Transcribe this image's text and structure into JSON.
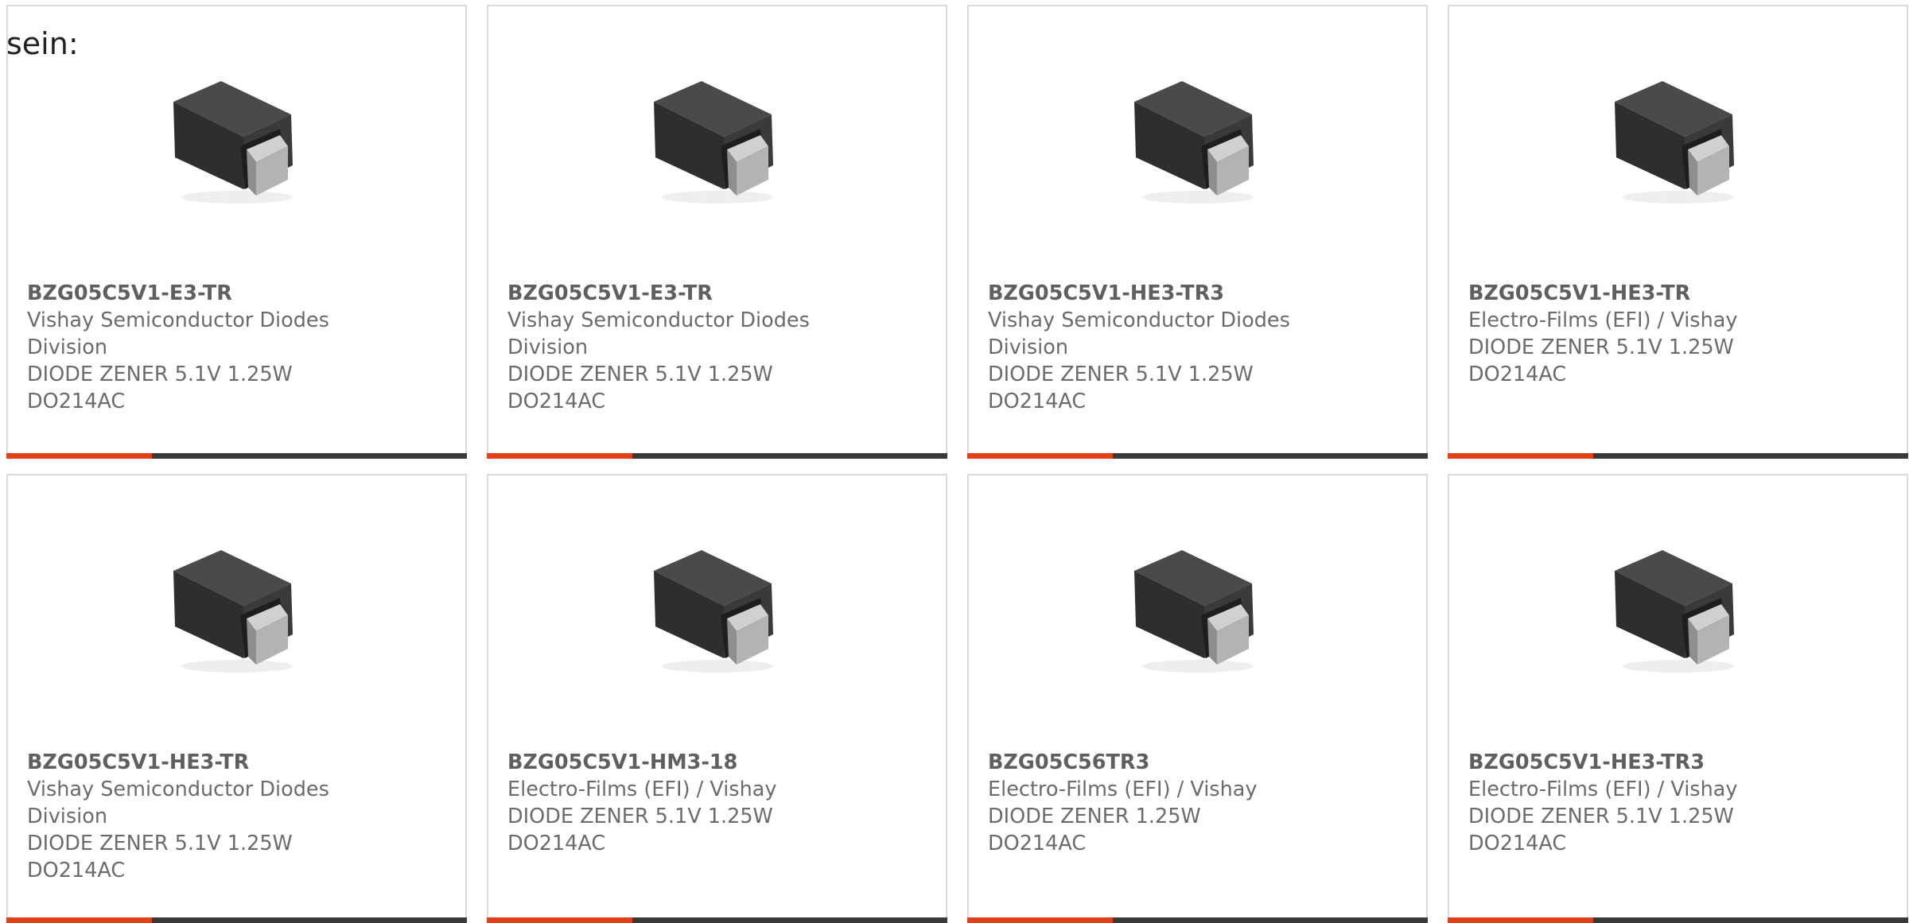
{
  "intro_text": "sein:",
  "colors": {
    "accent": "#e3411b",
    "bar_dark": "#3a3a3a",
    "border": "#d9d9d9",
    "text": "#6b6b6b"
  },
  "products": [
    {
      "part_number": "BZG05C5V1-E3-TR",
      "manufacturer": "Vishay Semiconductor Diodes Division",
      "description": "DIODE ZENER 5.1V 1.25W DO214AC",
      "image_icon": "diode-package-icon"
    },
    {
      "part_number": "BZG05C5V1-E3-TR",
      "manufacturer": "Vishay Semiconductor Diodes Division",
      "description": "DIODE ZENER 5.1V 1.25W DO214AC",
      "image_icon": "diode-package-icon"
    },
    {
      "part_number": "BZG05C5V1-HE3-TR3",
      "manufacturer": "Vishay Semiconductor Diodes Division",
      "description": "DIODE ZENER 5.1V 1.25W DO214AC",
      "image_icon": "diode-package-icon"
    },
    {
      "part_number": "BZG05C5V1-HE3-TR",
      "manufacturer": "Electro-Films (EFI) / Vishay",
      "description": "DIODE ZENER 5.1V 1.25W DO214AC",
      "image_icon": "diode-package-icon"
    },
    {
      "part_number": "BZG05C5V1-HE3-TR",
      "manufacturer": "Vishay Semiconductor Diodes Division",
      "description": "DIODE ZENER 5.1V 1.25W DO214AC",
      "image_icon": "diode-package-icon"
    },
    {
      "part_number": "BZG05C5V1-HM3-18",
      "manufacturer": "Electro-Films (EFI) / Vishay",
      "description": "DIODE ZENER 5.1V 1.25W DO214AC",
      "image_icon": "diode-package-icon"
    },
    {
      "part_number": "BZG05C56TR3",
      "manufacturer": "Electro-Films (EFI) / Vishay",
      "description": "DIODE ZENER 1.25W DO214AC",
      "image_icon": "diode-package-icon"
    },
    {
      "part_number": "BZG05C5V1-HE3-TR3",
      "manufacturer": "Electro-Films (EFI) / Vishay",
      "description": "DIODE ZENER 5.1V 1.25W DO214AC",
      "image_icon": "diode-package-icon"
    }
  ]
}
